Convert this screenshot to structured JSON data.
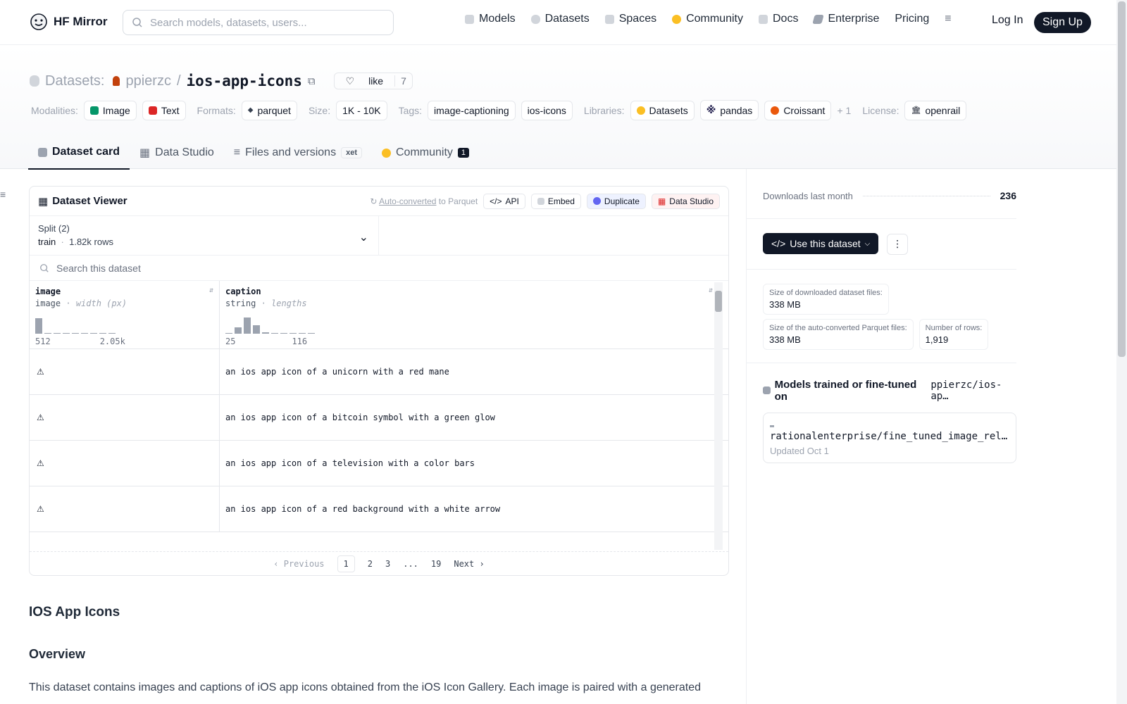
{
  "nav": {
    "brand": "HF Mirror",
    "search_placeholder": "Search models, datasets, users...",
    "links": [
      {
        "label": "Models",
        "icon": "cube-icon",
        "color": "#9ca3af"
      },
      {
        "label": "Datasets",
        "icon": "database-icon",
        "color": "#9ca3af"
      },
      {
        "label": "Spaces",
        "icon": "grid-icon",
        "color": "#9ca3af"
      },
      {
        "label": "Community",
        "icon": "chat-icon",
        "color": "#f59e0b"
      },
      {
        "label": "Docs",
        "icon": "book-icon",
        "color": "#9ca3af"
      },
      {
        "label": "Enterprise",
        "icon": "tag-icon",
        "color": "#9ca3af"
      },
      {
        "label": "Pricing",
        "icon": "",
        "color": ""
      }
    ],
    "login": "Log In",
    "signup": "Sign Up"
  },
  "dataset": {
    "section": "Datasets:",
    "owner": "ppierzc",
    "name": "ios-app-icons",
    "like_label": "like",
    "like_count": "7"
  },
  "tags": {
    "modalities_label": "Modalities:",
    "modalities": [
      "Image",
      "Text"
    ],
    "formats_label": "Formats:",
    "format": "parquet",
    "size_label": "Size:",
    "size": "1K - 10K",
    "tags_label": "Tags:",
    "tags": [
      "image-captioning",
      "ios-icons"
    ],
    "libraries_label": "Libraries:",
    "libraries": [
      "Datasets",
      "pandas",
      "Croissant"
    ],
    "more": "+ 1",
    "license_label": "License:",
    "license": "openrail"
  },
  "tabs": [
    {
      "label": "Dataset card"
    },
    {
      "label": "Data Studio"
    },
    {
      "label": "Files and versions",
      "badge": "xet"
    },
    {
      "label": "Community",
      "badge": "1"
    }
  ],
  "viewer": {
    "title": "Dataset Viewer",
    "auto_link": "Auto-converted",
    "auto_suffix": "to Parquet",
    "btn_api": "API",
    "btn_embed": "Embed",
    "btn_duplicate": "Duplicate",
    "btn_studio": "Data Studio",
    "split_label": "Split (2)",
    "split_value": "train",
    "split_rows": "1.82k rows",
    "search_placeholder": "Search this dataset",
    "columns": [
      {
        "name": "image",
        "type": "image",
        "stat": "width (px)",
        "min": "512",
        "max": "2.05k",
        "hist": [
          0.85,
          0.0,
          0.05,
          0,
          0,
          0,
          0,
          0,
          0.05
        ]
      },
      {
        "name": "caption",
        "type": "string",
        "stat": "lengths",
        "min": "25",
        "max": "116",
        "hist": [
          0.05,
          0.35,
          0.9,
          0.45,
          0.08,
          0.03,
          0.03,
          0.03,
          0,
          0.03
        ]
      }
    ],
    "rows": [
      "an ios app icon of a unicorn with a red mane",
      "an ios app icon of a bitcoin symbol with a green glow",
      "an ios app icon of a television with a color bars",
      "an ios app icon of a red background with a white arrow"
    ],
    "pager": {
      "prev": "Previous",
      "pages": [
        "1",
        "2",
        "3",
        "...",
        "19"
      ],
      "next": "Next"
    }
  },
  "sidebar": {
    "downloads_label": "Downloads last month",
    "downloads": "236",
    "use_btn": "Use this dataset",
    "stat_downloaded_label": "Size of downloaded dataset files:",
    "stat_downloaded": "338 MB",
    "stat_parquet_label": "Size of the auto-converted Parquet files:",
    "stat_parquet": "338 MB",
    "stat_rows_label": "Number of rows:",
    "stat_rows": "1,919",
    "models_title": "Models trained or fine-tuned on",
    "models_repo": "ppierzc/ios-ap…",
    "model_name": "rationalenterprise/fine_tuned_image_rel…",
    "model_updated": "Updated Oct 1"
  },
  "card": {
    "h1": "IOS App Icons",
    "h2": "Overview",
    "para": "This dataset contains images and captions of iOS app icons obtained from the iOS Icon Gallery. Each image is paired with a generated"
  }
}
